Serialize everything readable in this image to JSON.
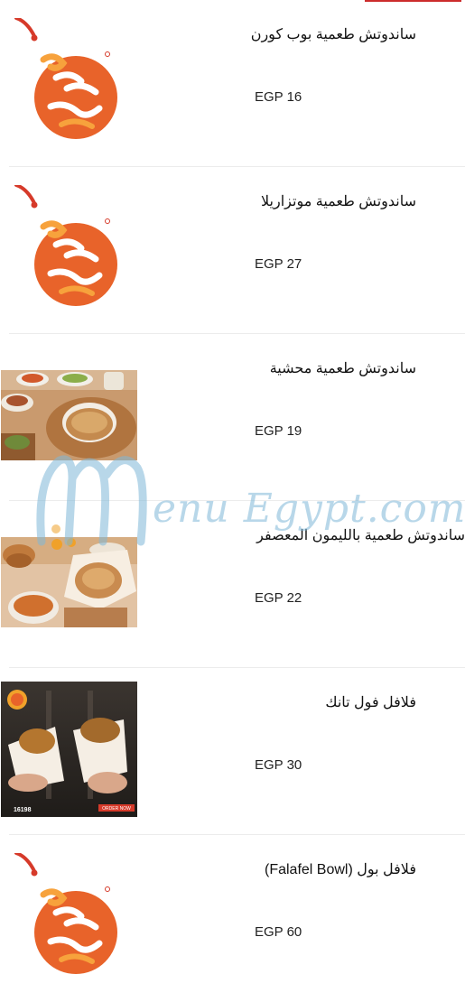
{
  "menu": {
    "items": [
      {
        "name": "ساندوتش طعمية بوب كورن",
        "price": "EGP 16",
        "image": "logo"
      },
      {
        "name": "ساندوتش طعمية موتزاريلا",
        "price": "EGP 27",
        "image": "logo"
      },
      {
        "name": "ساندوتش طعمية محشية",
        "price": "EGP 19",
        "image": "photo"
      },
      {
        "name": "ساندوتش طعمية بالليمون المعصفر",
        "price": "EGP 22",
        "image": "photo"
      },
      {
        "name": "فلافل فول تانك",
        "price": "EGP 30",
        "image": "photo"
      },
      {
        "name": "فلافل بول (Falafel Bowl)",
        "price": "EGP 60",
        "image": "logo"
      }
    ]
  },
  "watermark": {
    "text": "enu Egypt.com"
  },
  "promo": {
    "hotline": "16198",
    "order_label": "ORDER NOW"
  },
  "colors": {
    "accent": "#cc2b2b",
    "logo_orange": "#e8632a",
    "logo_red": "#d63a2a",
    "watermark": "#7fb8d8"
  }
}
